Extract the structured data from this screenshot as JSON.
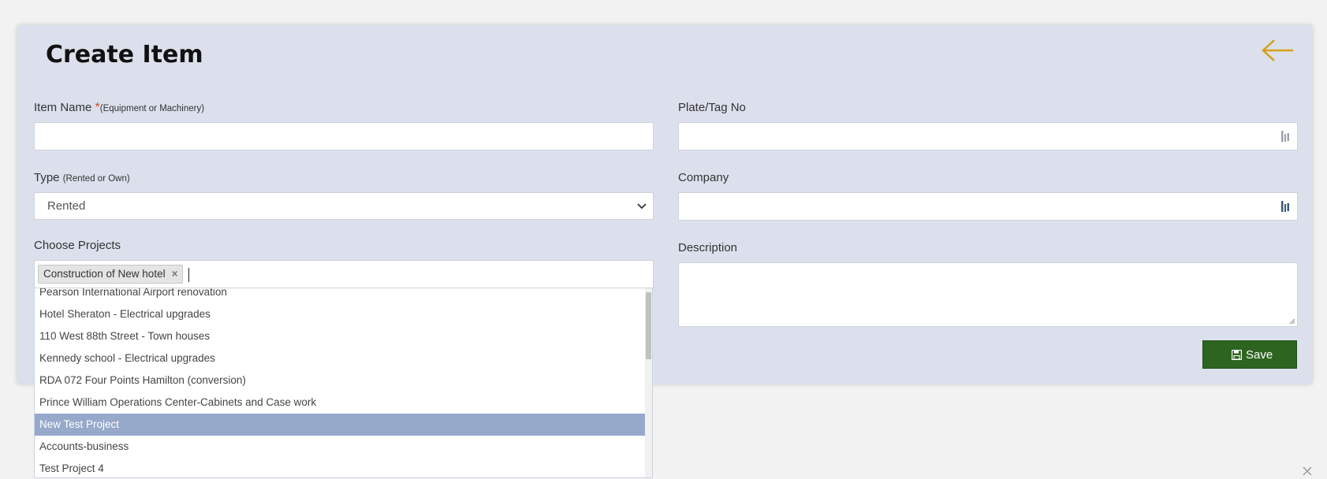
{
  "page": {
    "title": "Create Item",
    "back_icon": "arrow-left-icon",
    "close_icon": "close-icon",
    "accent_color": "#d4a017",
    "save_color": "#2d6420"
  },
  "form": {
    "item_name": {
      "label": "Item Name ",
      "required_mark": "*",
      "hint": "(Equipment or Machinery)",
      "value": ""
    },
    "plate_tag": {
      "label": "Plate/Tag No",
      "value": "",
      "icon": "picker-icon"
    },
    "type": {
      "label": "Type ",
      "hint": "(Rented or Own)",
      "selected": "Rented"
    },
    "company": {
      "label": "Company",
      "value": "",
      "icon": "picker-icon"
    },
    "projects": {
      "label": "Choose Projects",
      "selected_chips": [
        "Construction of New hotel"
      ],
      "chip_remove": "×"
    },
    "description": {
      "label": "Description",
      "value": ""
    },
    "save_label": "Save"
  },
  "dropdown": {
    "items": [
      "Pearson International Airport renovation",
      "Hotel Sheraton - Electrical upgrades",
      "110 West 88th Street - Town houses",
      "Kennedy school - Electrical upgrades",
      "RDA 072 Four Points Hamilton (conversion)",
      "Prince William Operations Center-Cabinets and Case work",
      "New Test Project",
      "Accounts-business",
      "Test Project 4"
    ],
    "highlighted": "New Test Project"
  }
}
